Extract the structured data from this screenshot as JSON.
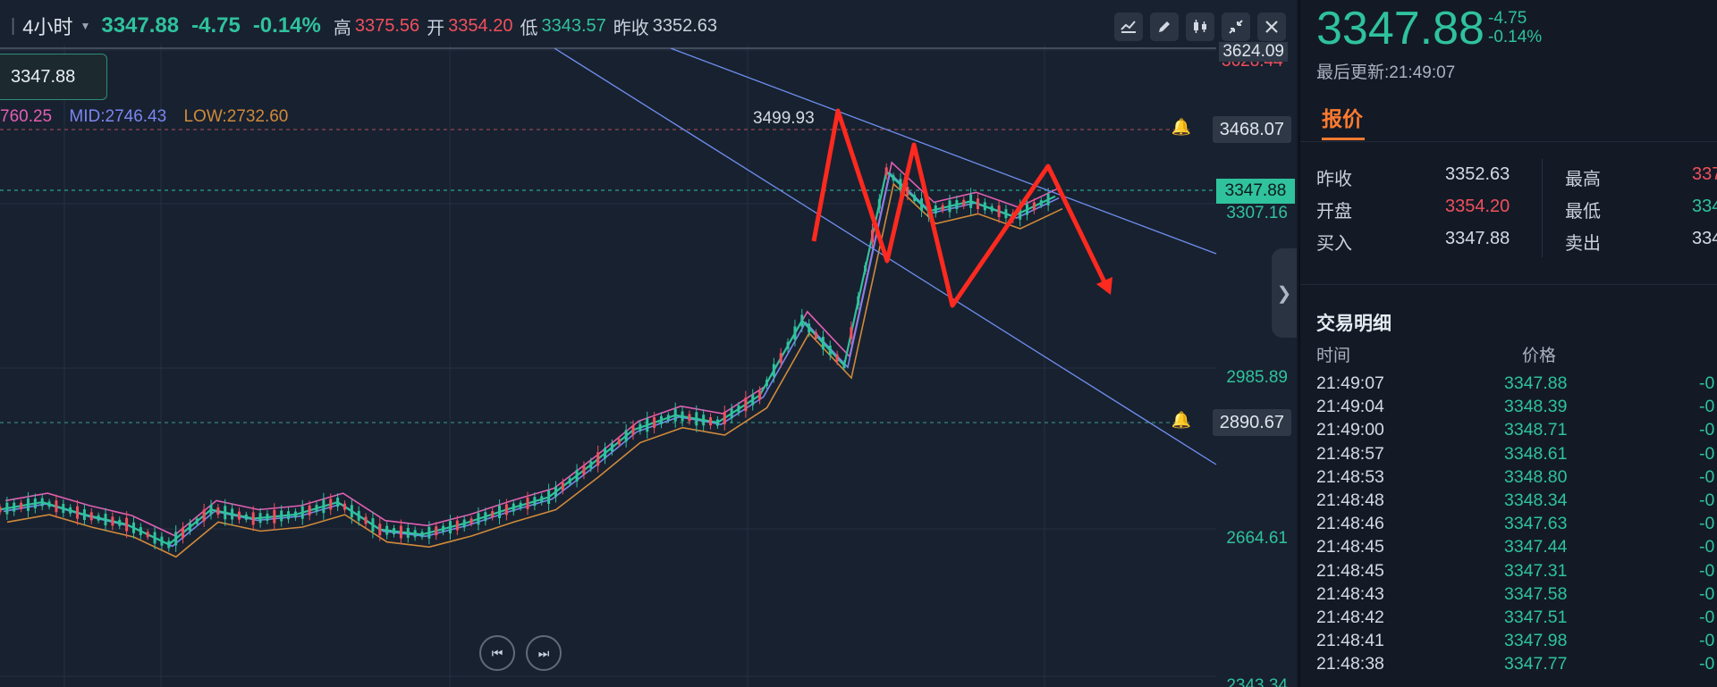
{
  "header": {
    "interval": "4小时",
    "last": "3347.88",
    "change": "-4.75",
    "change_pct": "-0.14%",
    "high_label": "高",
    "high": "3375.56",
    "open_label": "开",
    "open": "3354.20",
    "low_label": "低",
    "low": "3343.57",
    "prev_close_label": "昨收",
    "prev_close": "3352.63"
  },
  "toolbar_icons": [
    "indicator-icon",
    "pencil-icon",
    "candlestick-icon",
    "compress-icon",
    "close-icon"
  ],
  "price_tag": "3347.88",
  "band_legend": {
    "up": "760.25",
    "mid": "MID:2746.43",
    "low": "LOW:2732.60",
    "colors": {
      "up": "#e25fb4",
      "mid": "#7a86f0",
      "low": "#d08a3a"
    }
  },
  "price_axis": {
    "labels": [
      "3624.09",
      "3307.16",
      "2985.89",
      "2664.61",
      "2343.34"
    ],
    "clipped_label": "3628.44"
  },
  "alerts": [
    "3468.07",
    "2890.67"
  ],
  "current_price_label": "3347.88",
  "peak_annotation": "3499.93",
  "right_panel": {
    "price": "3347.88",
    "change": "-4.75",
    "change_pct": "-0.14%",
    "last_update": "最后更新:21:49:07",
    "tab": "报价",
    "quote": {
      "prev_close_label": "昨收",
      "prev_close": "3352.63",
      "open_label": "开盘",
      "open": "3354.20",
      "bid_label": "买入",
      "bid": "3347.88",
      "high_label": "最高",
      "high": "337",
      "low_label": "最低",
      "low": "334",
      "ask_label": "卖出",
      "ask": "334"
    },
    "trades_title": "交易明细",
    "col_time": "时间",
    "col_price": "价格",
    "trades": [
      {
        "time": "21:49:07",
        "price": "3347.88",
        "chg": "-0"
      },
      {
        "time": "21:49:04",
        "price": "3348.39",
        "chg": "-0"
      },
      {
        "time": "21:49:00",
        "price": "3348.71",
        "chg": "-0"
      },
      {
        "time": "21:48:57",
        "price": "3348.61",
        "chg": "-0"
      },
      {
        "time": "21:48:53",
        "price": "3348.80",
        "chg": "-0"
      },
      {
        "time": "21:48:48",
        "price": "3348.34",
        "chg": "-0"
      },
      {
        "time": "21:48:46",
        "price": "3347.63",
        "chg": "-0"
      },
      {
        "time": "21:48:45",
        "price": "3347.44",
        "chg": "-0"
      },
      {
        "time": "21:48:45",
        "price": "3347.31",
        "chg": "-0"
      },
      {
        "time": "21:48:43",
        "price": "3347.58",
        "chg": "-0"
      },
      {
        "time": "21:48:42",
        "price": "3347.51",
        "chg": "-0"
      },
      {
        "time": "21:48:41",
        "price": "3347.98",
        "chg": "-0"
      },
      {
        "time": "21:48:38",
        "price": "3347.77",
        "chg": "-0"
      }
    ]
  },
  "colors": {
    "up": "#2fc29d",
    "down": "#f0505c",
    "accent": "#ff7a2f",
    "trendline": "#6f8ff0",
    "arrow": "#ff2a1f"
  },
  "chart_data": {
    "type": "line",
    "title": "",
    "xlabel": "",
    "ylabel": "",
    "ylim": [
      2343.34,
      3624.09
    ],
    "x": [
      0,
      10,
      20,
      30,
      40,
      50,
      60,
      70,
      80,
      90,
      100,
      110,
      120,
      130,
      140,
      150,
      160,
      170,
      180,
      190,
      200,
      210,
      220,
      230,
      240,
      250
    ],
    "series": [
      {
        "values": [
          2700,
          2715,
          2690,
          2670,
          2630,
          2700,
          2682,
          2690,
          2715,
          2660,
          2650,
          2672,
          2700,
          2725,
          2790,
          2860,
          2890,
          2875,
          2930,
          3080,
          2990,
          3380,
          3300,
          3320,
          3290,
          3330
        ]
      }
    ]
  }
}
